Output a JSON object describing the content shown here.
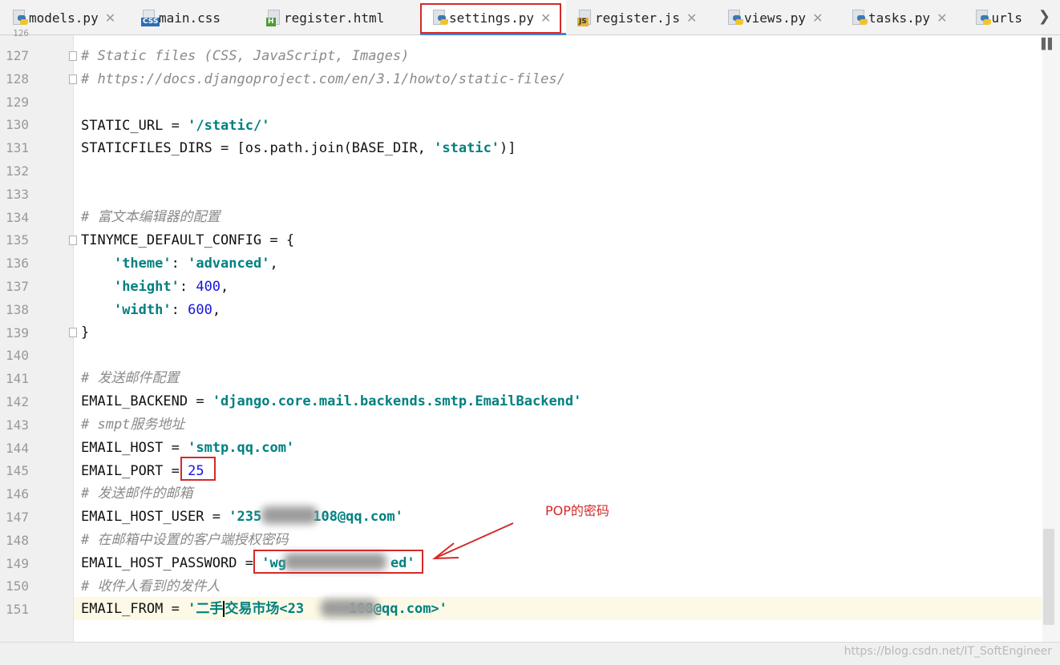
{
  "tabs": [
    {
      "label": "models.py",
      "icon": "python-file-icon"
    },
    {
      "label": "main.css",
      "icon": "css-file-icon",
      "badge": "CSS"
    },
    {
      "label": "register.html",
      "icon": "html-file-icon",
      "badge": "H"
    },
    {
      "label": "settings.py",
      "icon": "python-file-icon",
      "active": true
    },
    {
      "label": "register.js",
      "icon": "js-file-icon",
      "badge": "JS"
    },
    {
      "label": "views.py",
      "icon": "python-file-icon"
    },
    {
      "label": "tasks.py",
      "icon": "python-file-icon"
    },
    {
      "label": "urls",
      "icon": "python-file-icon"
    }
  ],
  "gutter": {
    "partial_top": "126",
    "line_numbers": [
      "127",
      "128",
      "129",
      "130",
      "131",
      "132",
      "133",
      "134",
      "135",
      "136",
      "137",
      "138",
      "139",
      "140",
      "141",
      "142",
      "143",
      "144",
      "145",
      "146",
      "147",
      "148",
      "149",
      "150",
      "151"
    ]
  },
  "code": {
    "l127": "# Static files (CSS, JavaScript, Images)",
    "l128": "# https://docs.djangoproject.com/en/3.1/howto/static-files/",
    "l130_var": "STATIC_URL",
    "l130_str": "'/static/'",
    "l131_var": "STATICFILES_DIRS",
    "l131_call": "[os.path.join(BASE_DIR, ",
    "l131_str": "'static'",
    "l131_end": ")]",
    "l134": "# 富文本编辑器的配置",
    "l135_var": "TINYMCE_DEFAULT_CONFIG",
    "l136_key": "'theme'",
    "l136_val": "'advanced'",
    "l137_key": "'height'",
    "l137_val": "400",
    "l138_key": "'width'",
    "l138_val": "600",
    "l139": "}",
    "l141": "# 发送邮件配置",
    "l142_var": "EMAIL_BACKEND",
    "l142_str": "'django.core.mail.backends.smtp.EmailBackend'",
    "l143": "# smpt服务地址",
    "l144_var": "EMAIL_HOST",
    "l144_str": "'smtp.qq.com'",
    "l145_var": "EMAIL_PORT",
    "l145_val": "25",
    "l146": "# 发送邮件的邮箱",
    "l147_var": "EMAIL_HOST_USER",
    "l147_str_a": "'235",
    "l147_str_b": "108@qq.com'",
    "l148": "# 在邮箱中设置的客户端授权密码",
    "l149_var": "EMAIL_HOST_PASSWORD",
    "l149_str_a": "'wg",
    "l149_str_b": "ed'",
    "l150": "# 收件人看到的发件人",
    "l151_var": "EMAIL_FROM",
    "l151_str_a": "'二手",
    "l151_str_b": "交易市场<23",
    "l151_str_c": "108@qq.com>'"
  },
  "annotation": {
    "label": "POP的密码",
    "color": "#d42a2a"
  },
  "watermark": "https://blog.csdn.net/IT_SoftEngineer",
  "colors": {
    "string": "#008080",
    "number": "#1515d6",
    "comment": "#8a8a8a",
    "annotation": "#d42a2a",
    "active_tab_underline": "#4a83d4",
    "current_line": "#fcf9e6"
  }
}
